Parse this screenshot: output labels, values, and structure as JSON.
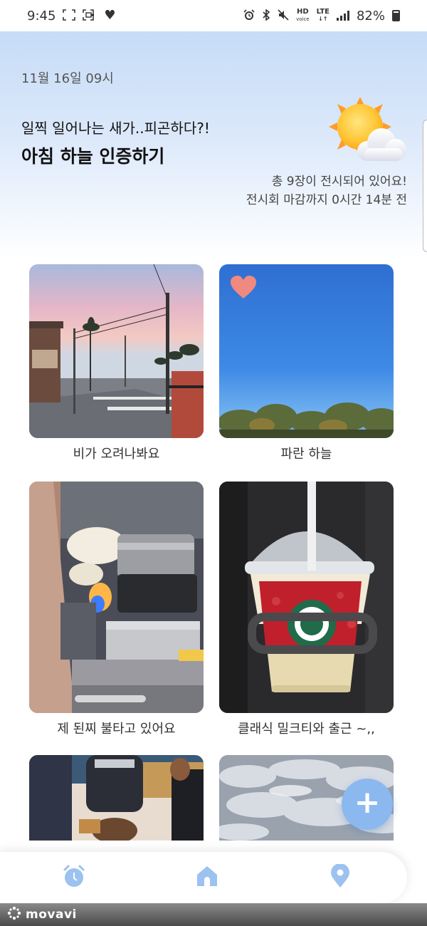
{
  "status_bar": {
    "time": "9:45",
    "battery": "82%",
    "hd_label": "HD",
    "voice_label": "voice",
    "lte_label": "LTE",
    "icons": [
      "screenshot-icon",
      "screen-record-icon",
      "heart-icon",
      "alarm-icon",
      "bluetooth-icon",
      "mute-icon",
      "signal-icon",
      "battery-icon"
    ]
  },
  "header": {
    "date": "11월 16일 09시",
    "subtitle": "일찍 일어나는 새가..피곤하다?!",
    "title": "아침 하늘 인증하기",
    "photo_count_text": "총 9장이 전시되어 있어요!",
    "deadline_text": "전시회 마감까지 0시간 14분 전",
    "weather_icon": "sun-behind-cloud-icon"
  },
  "gallery": {
    "items": [
      {
        "caption": "비가 오려나봐요",
        "liked": false
      },
      {
        "caption": "파란 하늘",
        "liked": true
      },
      {
        "caption": "제 된찌 불타고 있어요",
        "liked": false
      },
      {
        "caption": "클래식 밀크티와 출근 ~,,",
        "liked": false
      },
      {
        "caption": "",
        "liked": false
      },
      {
        "caption": "",
        "liked": false
      }
    ]
  },
  "fab": {
    "label": "+"
  },
  "nav": {
    "items": [
      "alarm-clock-icon",
      "home-icon",
      "location-pin-icon"
    ]
  },
  "watermark": {
    "text": "movavi"
  },
  "colors": {
    "accent": "#8cb8f0",
    "header_gradient_top": "#c6dcf7",
    "heart": "#f08a80"
  }
}
